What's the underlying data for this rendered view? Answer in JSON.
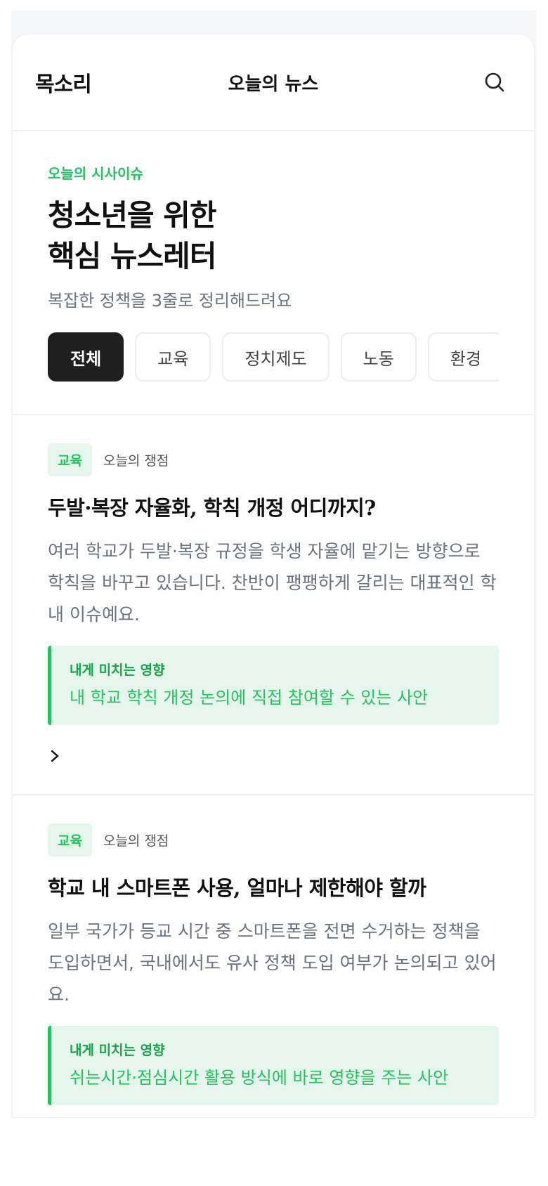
{
  "header": {
    "brand": "목소리",
    "title": "오늘의 뉴스",
    "search_icon": "search-icon"
  },
  "hero": {
    "kicker": "오늘의 시사이슈",
    "title_line1": "청소년을 위한",
    "title_line2": "핵심 뉴스레터",
    "subtitle": "복잡한 정책을 3줄로 정리해드려요",
    "chips": [
      {
        "label": "전체",
        "active": true
      },
      {
        "label": "교육",
        "active": false
      },
      {
        "label": "정치제도",
        "active": false
      },
      {
        "label": "노동",
        "active": false
      },
      {
        "label": "환경",
        "active": false
      }
    ]
  },
  "cards": [
    {
      "tag": "교육",
      "meta": "오늘의 쟁점",
      "title": "두발·복장 자율화, 학칙 개정 어디까지?",
      "body": "여러 학교가 두발·복장 규정을 학생 자율에 맡기는 방향으로 학칙을 바꾸고 있습니다. 찬반이 팽팽하게 갈리는 대표적인 학내 이슈예요.",
      "impact_label": "내게 미치는 영향",
      "impact_text": "내 학교 학칙 개정 논의에 직접 참여할 수 있는 사안",
      "more_icon": "chevron-right-icon"
    },
    {
      "tag": "교육",
      "meta": "오늘의 쟁점",
      "title": "학교 내 스마트폰 사용, 얼마나 제한해야 할까",
      "body": "일부 국가가 등교 시간 중 스마트폰을 전면 수거하는 정책을 도입하면서, 국내에서도 유사 정책 도입 여부가 논의되고 있어요.",
      "impact_label": "내게 미치는 영향",
      "impact_text": "쉬는시간·점심시간 활용 방식에 바로 영향을 주는 사안"
    }
  ],
  "colors": {
    "accent": "#22c55e",
    "accent_bg": "#e6f6ec",
    "chip_active_bg": "#1f1f1f",
    "muted_text": "#6b7280"
  }
}
